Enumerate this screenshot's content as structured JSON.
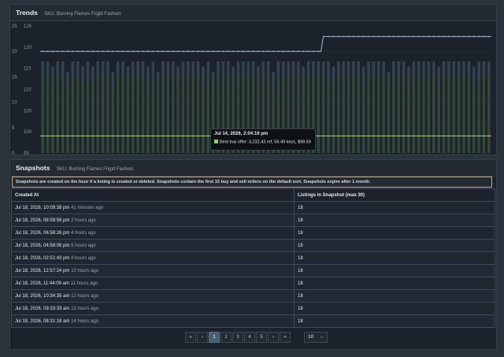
{
  "trends": {
    "title": "Trends",
    "sku_label": "SKU: Burning Flames Frigid Fashion",
    "tooltip": {
      "date": "Jul 14, 2026, 2:04:16 pm",
      "series": "Best buy offer: 3,232.43 ref, 56.49 keys, $98.59",
      "swatch_color": "#8fcf6a"
    }
  },
  "chart_data": {
    "type": "bar",
    "y_left_ticks": [
      "0",
      "5",
      "10",
      "15",
      "20",
      "25"
    ],
    "y_right_ticks": [
      "95",
      "100",
      "105",
      "110",
      "115",
      "120",
      "125"
    ],
    "y_left_range": [
      0,
      25
    ],
    "y_right_range": [
      95,
      125
    ],
    "series": [
      {
        "color": "#9db7d6",
        "step_level_before": 119,
        "step_level_after": 122.5
      },
      {
        "color": "#8fcf6a",
        "level": 99
      }
    ],
    "bar_count": 90,
    "bar_heights": [
      18,
      18,
      17,
      18,
      18,
      16,
      18,
      18,
      17,
      18,
      17,
      18,
      18,
      18,
      16,
      18,
      18,
      17,
      18,
      18,
      18,
      17,
      18,
      16,
      18,
      18,
      18,
      17,
      18,
      18,
      18,
      18,
      17,
      18,
      16,
      18,
      18,
      18,
      17,
      18,
      18,
      18,
      18,
      17,
      18,
      18,
      16,
      18,
      18,
      18,
      18,
      18,
      17,
      18,
      18,
      18,
      18,
      18,
      17,
      18,
      18,
      18,
      18,
      18,
      17,
      18,
      18,
      18,
      18,
      16,
      18,
      18,
      18,
      17,
      18,
      18,
      18,
      18,
      18,
      17,
      18,
      18,
      18,
      18,
      18,
      18,
      17,
      18,
      18,
      18
    ]
  },
  "snapshots": {
    "title": "Snapshots",
    "sku_label": "SKU: Burning Flames Frigid Fashion",
    "notice": "Snapshots are created on the hour if a listing is created or deleted. Snapshots contain the first 15 buy and sell orders on the default sort. Snapshots expire after 1 month.",
    "columns": [
      "Created At",
      "Listings in Snapshot (max 30)"
    ],
    "rows": [
      {
        "created": "Jul 18, 2026, 10:09:38 pm",
        "ago": "41 minutes ago",
        "count": "18"
      },
      {
        "created": "Jul 18, 2026, 08:59:56 pm",
        "ago": "2 hours ago",
        "count": "18"
      },
      {
        "created": "Jul 18, 2026, 06:58:26 pm",
        "ago": "4 hours ago",
        "count": "18"
      },
      {
        "created": "Jul 18, 2026, 04:58:06 pm",
        "ago": "6 hours ago",
        "count": "18"
      },
      {
        "created": "Jul 18, 2026, 02:51:43 pm",
        "ago": "8 hours ago",
        "count": "18"
      },
      {
        "created": "Jul 18, 2026, 12:57:24 pm",
        "ago": "10 hours ago",
        "count": "18"
      },
      {
        "created": "Jul 18, 2026, 11:44:09 am",
        "ago": "11 hours ago",
        "count": "18"
      },
      {
        "created": "Jul 18, 2026, 10:34:35 am",
        "ago": "12 hours ago",
        "count": "18"
      },
      {
        "created": "Jul 18, 2026, 09:33:33 am",
        "ago": "13 hours ago",
        "count": "18"
      },
      {
        "created": "Jul 18, 2026, 08:31:18 am",
        "ago": "14 hours ago",
        "count": "18"
      }
    ],
    "pagination": {
      "first": "«",
      "prev": "‹",
      "pages": [
        "1",
        "2",
        "3",
        "4",
        "5"
      ],
      "active_page": "1",
      "next": "›",
      "last": "»",
      "per_page": "10"
    }
  }
}
